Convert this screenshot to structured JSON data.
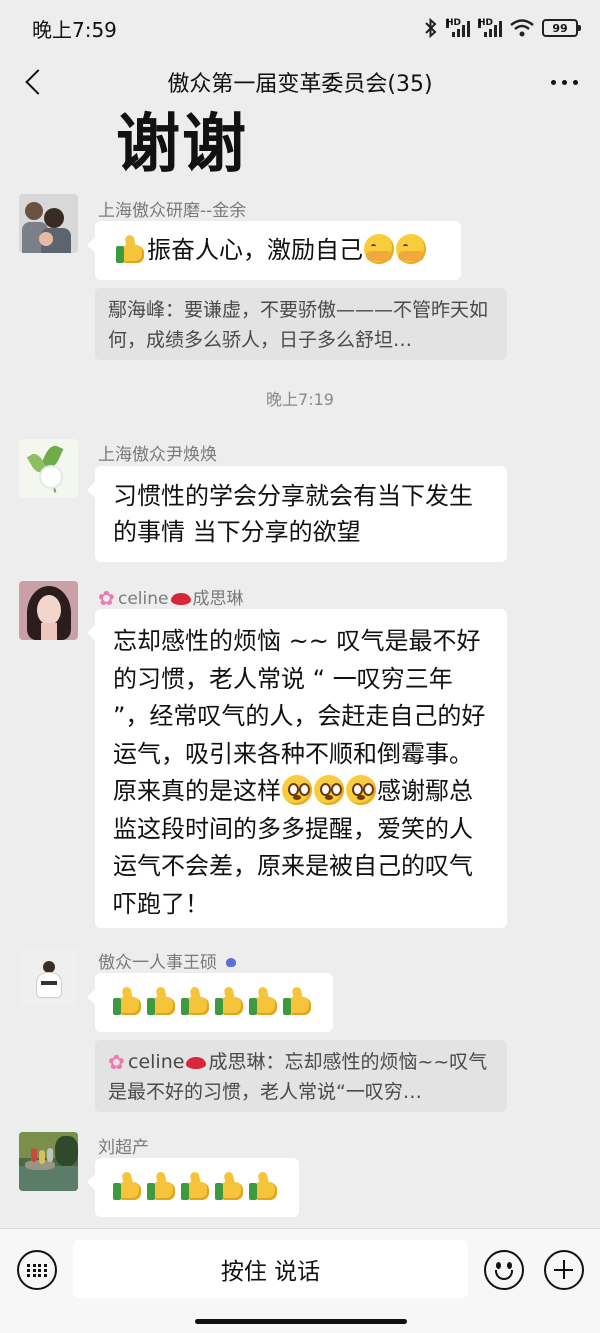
{
  "status_bar": {
    "time": "晚上7:59",
    "battery": "99",
    "hd1": "HD",
    "hd2": "HD"
  },
  "header": {
    "title": "傲众第一届变革委员会(35)"
  },
  "sticker": {
    "text": "谢谢"
  },
  "messages": [
    {
      "sender": "上海傲众研磨--金余",
      "text": "振奋人心，激励自己"
    },
    {
      "quote": "鄢海峰：要谦虚，不要骄傲———不管昨天如何，成绩多么骄人，日子多么舒坦…"
    },
    {
      "time": "晚上7:19"
    },
    {
      "sender": "上海傲众尹焕焕",
      "text": "习惯性的学会分享就会有当下发生的事情 当下分享的欲望"
    },
    {
      "sender_name": "celine",
      "sender_suffix": "成思琳",
      "text_part1": "忘却感性的烦恼 ~~ 叹气是最不好的习惯，老人常说 “ 一叹穷三年 ”，经常叹气的人，会赶走自己的好运气，吸引来各种不顺和倒霉事。原来真的是这样",
      "text_part2": "感谢鄢总监这段时间的多多提醒，爱笑的人运气不会差，原来是被自己的叹气吓跑了！"
    },
    {
      "sender": "傲众一人事王硕"
    },
    {
      "quote_name": "celine",
      "quote_rest": "成思琳：忘却感性的烦恼~~叹气是最不好的习惯，老人常说“一叹穷…"
    },
    {
      "sender": "刘超产"
    }
  ],
  "input_bar": {
    "hold_to_talk": "按住 说话"
  },
  "icons": [
    "back-icon",
    "more-icon",
    "keyboard-icon",
    "emoji-icon",
    "plus-icon",
    "thumbs-up-icon",
    "hug-face-icon",
    "flushed-face-icon"
  ]
}
